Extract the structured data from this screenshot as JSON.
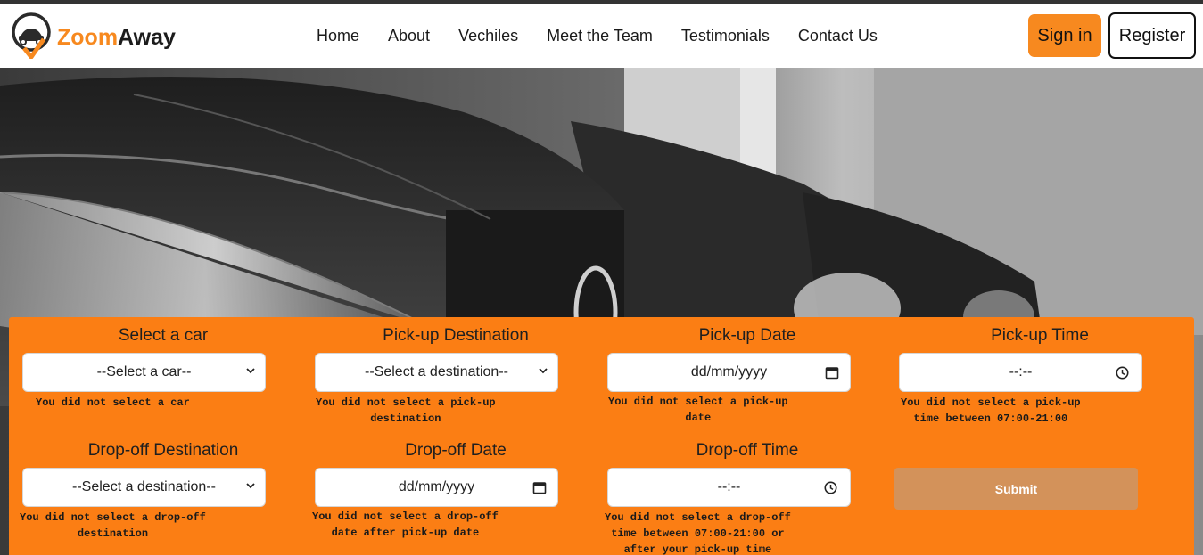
{
  "brand": {
    "part1": "Zoom",
    "part2": "Away",
    "accent_color": "#f7891f"
  },
  "nav": {
    "links": [
      "Home",
      "About",
      "Vechiles",
      "Meet the Team",
      "Testimonials",
      "Contact Us"
    ]
  },
  "auth": {
    "signin_label": "Sign in",
    "register_label": "Register"
  },
  "form": {
    "panel_color": "#fb7e14",
    "car": {
      "label": "Select a car",
      "value": "--Select a car--",
      "error": "You did not select a car"
    },
    "pickup_destination": {
      "label": "Pick-up Destination",
      "value": "--Select a destination--",
      "error": "You did not select a pick-up\ndestination"
    },
    "pickup_date": {
      "label": "Pick-up Date",
      "value": "dd/mm/yyyy",
      "error": "You did not select a pick-up\ndate"
    },
    "pickup_time": {
      "label": "Pick-up Time",
      "value": "--:--",
      "error": "You did not select a pick-up\ntime between 07:00-21:00"
    },
    "dropoff_destination": {
      "label": "Drop-off Destination",
      "value": "--Select a destination--",
      "error": "You did not select a drop-off\ndestination"
    },
    "dropoff_date": {
      "label": "Drop-off Date",
      "value": "dd/mm/yyyy",
      "error": "You did not select a drop-off\ndate after pick-up date"
    },
    "dropoff_time": {
      "label": "Drop-off Time",
      "value": "--:--",
      "error": "You did not select a drop-off\ntime between 07:00-21:00 or\nafter your pick-up time"
    },
    "submit_label": "Submit"
  }
}
